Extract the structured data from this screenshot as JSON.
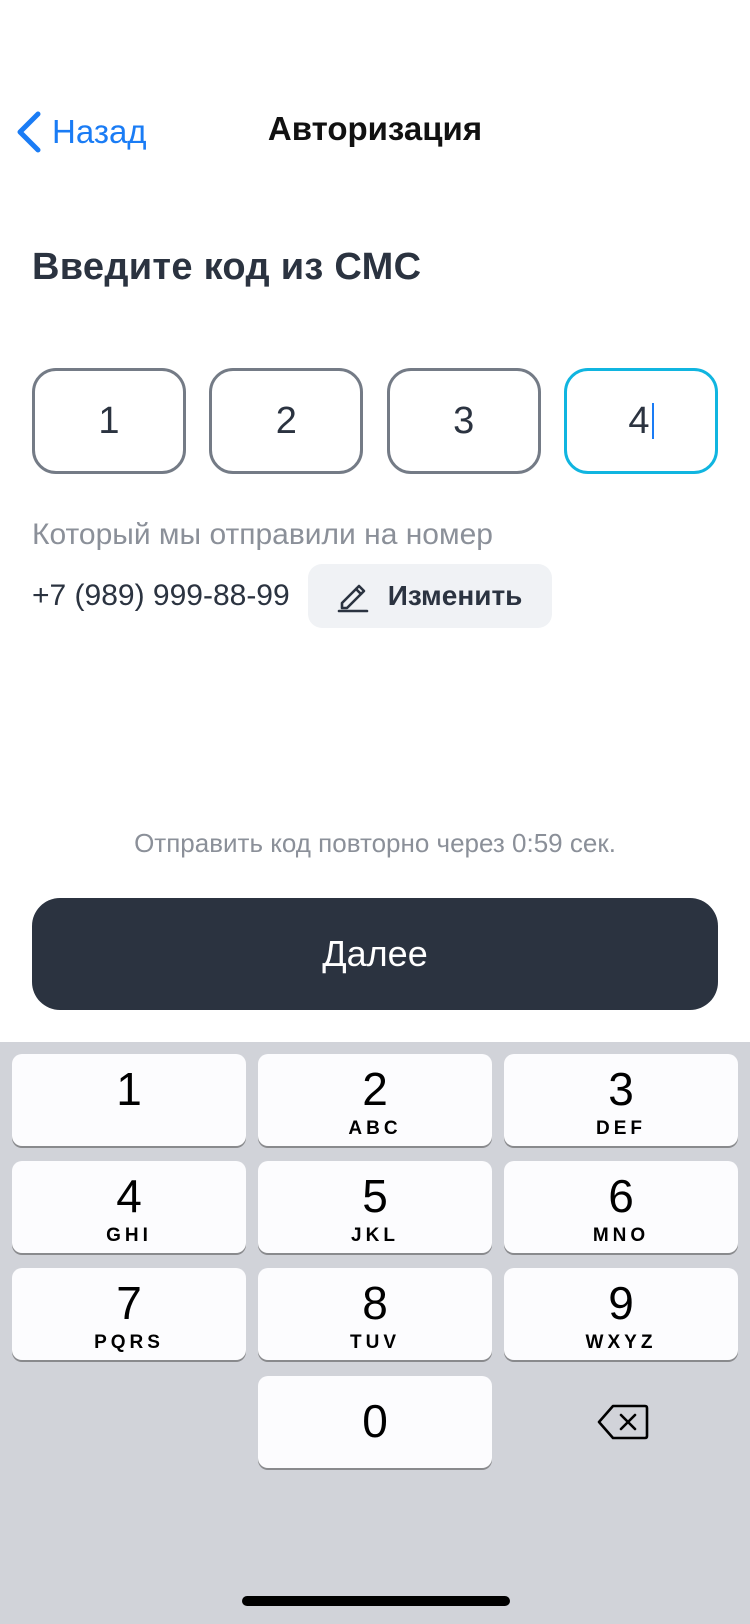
{
  "nav": {
    "back_label": "Назад",
    "title": "Авторизация"
  },
  "heading": "Введите код из СМС",
  "code": {
    "digits": [
      "1",
      "2",
      "3",
      "4"
    ],
    "active_index": 3
  },
  "subtitle": "Который мы отправили на номер",
  "phone": {
    "number": "+7 (989) 999-88-99",
    "change_label": "Изменить"
  },
  "resend_text": "Отправить код повторно через 0:59 сек.",
  "next_label": "Далее",
  "keyboard": {
    "keys": [
      {
        "digit": "1",
        "letters": ""
      },
      {
        "digit": "2",
        "letters": "ABC"
      },
      {
        "digit": "3",
        "letters": "DEF"
      },
      {
        "digit": "4",
        "letters": "GHI"
      },
      {
        "digit": "5",
        "letters": "JKL"
      },
      {
        "digit": "6",
        "letters": "MNO"
      },
      {
        "digit": "7",
        "letters": "PQRS"
      },
      {
        "digit": "8",
        "letters": "TUV"
      },
      {
        "digit": "9",
        "letters": "WXYZ"
      },
      {
        "digit": "0",
        "letters": ""
      }
    ]
  },
  "colors": {
    "accent": "#1a7cf5",
    "active_border": "#10b5e0",
    "primary_button": "#2b3340",
    "keyboard_bg": "#d1d3d9"
  },
  "icons": {
    "back": "chevron-left-icon",
    "edit": "pencil-icon",
    "delete": "backspace-icon"
  }
}
